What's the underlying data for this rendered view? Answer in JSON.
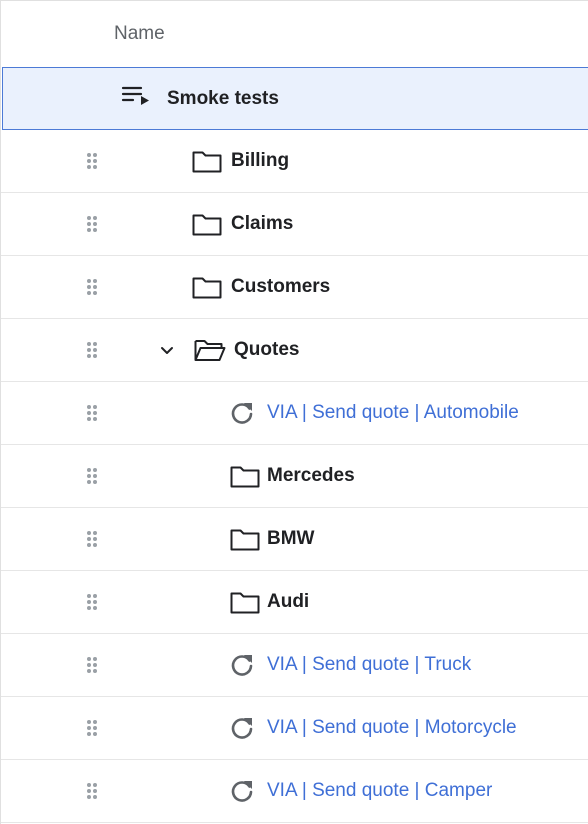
{
  "header": {
    "name_label": "Name"
  },
  "colors": {
    "link": "#3f6fd6",
    "selected_bg": "#eaf1fd",
    "selected_border": "#4c7ad6"
  },
  "rows": [
    {
      "label": "Smoke tests",
      "type": "suite",
      "depth": 0,
      "selected": true
    },
    {
      "label": "Billing",
      "type": "folder",
      "depth": 1
    },
    {
      "label": "Claims",
      "type": "folder",
      "depth": 1
    },
    {
      "label": "Customers",
      "type": "folder",
      "depth": 1
    },
    {
      "label": "Quotes",
      "type": "folder-open",
      "depth": 1,
      "expanded": true
    },
    {
      "label": "VIA | Send quote | Automobile",
      "type": "test",
      "depth": 2
    },
    {
      "label": "Mercedes",
      "type": "folder",
      "depth": 2
    },
    {
      "label": "BMW",
      "type": "folder",
      "depth": 2
    },
    {
      "label": "Audi",
      "type": "folder",
      "depth": 2
    },
    {
      "label": "VIA | Send quote | Truck",
      "type": "test",
      "depth": 2
    },
    {
      "label": "VIA | Send quote | Motorcycle",
      "type": "test",
      "depth": 2
    },
    {
      "label": "VIA | Send quote | Camper",
      "type": "test",
      "depth": 2
    }
  ]
}
